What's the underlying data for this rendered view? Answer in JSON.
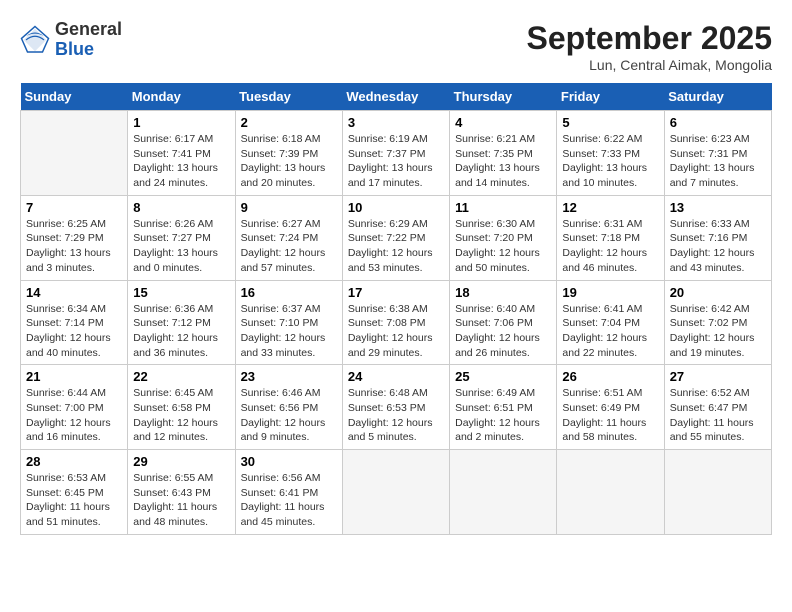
{
  "header": {
    "logo_general": "General",
    "logo_blue": "Blue",
    "month_title": "September 2025",
    "location": "Lun, Central Aimak, Mongolia"
  },
  "days_of_week": [
    "Sunday",
    "Monday",
    "Tuesday",
    "Wednesday",
    "Thursday",
    "Friday",
    "Saturday"
  ],
  "weeks": [
    [
      {
        "day": "",
        "info": ""
      },
      {
        "day": "1",
        "info": "Sunrise: 6:17 AM\nSunset: 7:41 PM\nDaylight: 13 hours and 24 minutes."
      },
      {
        "day": "2",
        "info": "Sunrise: 6:18 AM\nSunset: 7:39 PM\nDaylight: 13 hours and 20 minutes."
      },
      {
        "day": "3",
        "info": "Sunrise: 6:19 AM\nSunset: 7:37 PM\nDaylight: 13 hours and 17 minutes."
      },
      {
        "day": "4",
        "info": "Sunrise: 6:21 AM\nSunset: 7:35 PM\nDaylight: 13 hours and 14 minutes."
      },
      {
        "day": "5",
        "info": "Sunrise: 6:22 AM\nSunset: 7:33 PM\nDaylight: 13 hours and 10 minutes."
      },
      {
        "day": "6",
        "info": "Sunrise: 6:23 AM\nSunset: 7:31 PM\nDaylight: 13 hours and 7 minutes."
      }
    ],
    [
      {
        "day": "7",
        "info": "Sunrise: 6:25 AM\nSunset: 7:29 PM\nDaylight: 13 hours and 3 minutes."
      },
      {
        "day": "8",
        "info": "Sunrise: 6:26 AM\nSunset: 7:27 PM\nDaylight: 13 hours and 0 minutes."
      },
      {
        "day": "9",
        "info": "Sunrise: 6:27 AM\nSunset: 7:24 PM\nDaylight: 12 hours and 57 minutes."
      },
      {
        "day": "10",
        "info": "Sunrise: 6:29 AM\nSunset: 7:22 PM\nDaylight: 12 hours and 53 minutes."
      },
      {
        "day": "11",
        "info": "Sunrise: 6:30 AM\nSunset: 7:20 PM\nDaylight: 12 hours and 50 minutes."
      },
      {
        "day": "12",
        "info": "Sunrise: 6:31 AM\nSunset: 7:18 PM\nDaylight: 12 hours and 46 minutes."
      },
      {
        "day": "13",
        "info": "Sunrise: 6:33 AM\nSunset: 7:16 PM\nDaylight: 12 hours and 43 minutes."
      }
    ],
    [
      {
        "day": "14",
        "info": "Sunrise: 6:34 AM\nSunset: 7:14 PM\nDaylight: 12 hours and 40 minutes."
      },
      {
        "day": "15",
        "info": "Sunrise: 6:36 AM\nSunset: 7:12 PM\nDaylight: 12 hours and 36 minutes."
      },
      {
        "day": "16",
        "info": "Sunrise: 6:37 AM\nSunset: 7:10 PM\nDaylight: 12 hours and 33 minutes."
      },
      {
        "day": "17",
        "info": "Sunrise: 6:38 AM\nSunset: 7:08 PM\nDaylight: 12 hours and 29 minutes."
      },
      {
        "day": "18",
        "info": "Sunrise: 6:40 AM\nSunset: 7:06 PM\nDaylight: 12 hours and 26 minutes."
      },
      {
        "day": "19",
        "info": "Sunrise: 6:41 AM\nSunset: 7:04 PM\nDaylight: 12 hours and 22 minutes."
      },
      {
        "day": "20",
        "info": "Sunrise: 6:42 AM\nSunset: 7:02 PM\nDaylight: 12 hours and 19 minutes."
      }
    ],
    [
      {
        "day": "21",
        "info": "Sunrise: 6:44 AM\nSunset: 7:00 PM\nDaylight: 12 hours and 16 minutes."
      },
      {
        "day": "22",
        "info": "Sunrise: 6:45 AM\nSunset: 6:58 PM\nDaylight: 12 hours and 12 minutes."
      },
      {
        "day": "23",
        "info": "Sunrise: 6:46 AM\nSunset: 6:56 PM\nDaylight: 12 hours and 9 minutes."
      },
      {
        "day": "24",
        "info": "Sunrise: 6:48 AM\nSunset: 6:53 PM\nDaylight: 12 hours and 5 minutes."
      },
      {
        "day": "25",
        "info": "Sunrise: 6:49 AM\nSunset: 6:51 PM\nDaylight: 12 hours and 2 minutes."
      },
      {
        "day": "26",
        "info": "Sunrise: 6:51 AM\nSunset: 6:49 PM\nDaylight: 11 hours and 58 minutes."
      },
      {
        "day": "27",
        "info": "Sunrise: 6:52 AM\nSunset: 6:47 PM\nDaylight: 11 hours and 55 minutes."
      }
    ],
    [
      {
        "day": "28",
        "info": "Sunrise: 6:53 AM\nSunset: 6:45 PM\nDaylight: 11 hours and 51 minutes."
      },
      {
        "day": "29",
        "info": "Sunrise: 6:55 AM\nSunset: 6:43 PM\nDaylight: 11 hours and 48 minutes."
      },
      {
        "day": "30",
        "info": "Sunrise: 6:56 AM\nSunset: 6:41 PM\nDaylight: 11 hours and 45 minutes."
      },
      {
        "day": "",
        "info": ""
      },
      {
        "day": "",
        "info": ""
      },
      {
        "day": "",
        "info": ""
      },
      {
        "day": "",
        "info": ""
      }
    ]
  ]
}
